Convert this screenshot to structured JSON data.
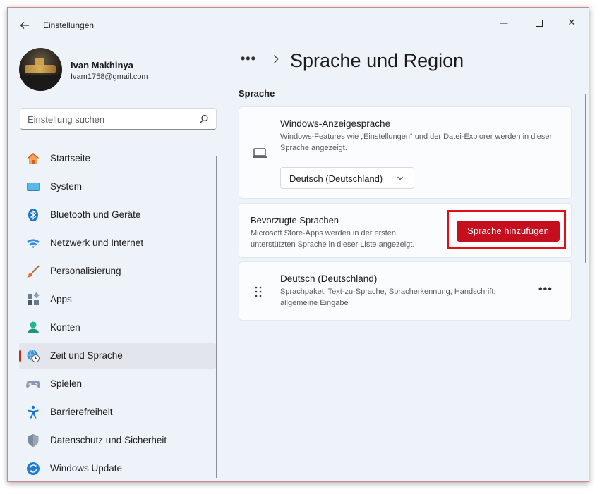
{
  "window": {
    "title": "Einstellungen",
    "back_icon": "arrow-left",
    "minimize": "—",
    "close": "✕"
  },
  "profile": {
    "name": "Ivan Makhinya",
    "email": "Ivam1758@gmail.com"
  },
  "search": {
    "placeholder": "Einstellung suchen"
  },
  "sidebar": {
    "items": [
      {
        "label": "Startseite",
        "icon": "home-icon"
      },
      {
        "label": "System",
        "icon": "system-display-icon"
      },
      {
        "label": "Bluetooth und Geräte",
        "icon": "bluetooth-icon"
      },
      {
        "label": "Netzwerk und Internet",
        "icon": "wifi-icon"
      },
      {
        "label": "Personalisierung",
        "icon": "paintbrush-icon"
      },
      {
        "label": "Apps",
        "icon": "apps-icon"
      },
      {
        "label": "Konten",
        "icon": "account-icon"
      },
      {
        "label": "Zeit und Sprache",
        "icon": "time-language-icon",
        "active": true
      },
      {
        "label": "Spielen",
        "icon": "gamepad-icon"
      },
      {
        "label": "Barrierefreiheit",
        "icon": "accessibility-icon"
      },
      {
        "label": "Datenschutz und Sicherheit",
        "icon": "shield-icon"
      },
      {
        "label": "Windows Update",
        "icon": "update-icon"
      }
    ]
  },
  "main": {
    "breadcrumb_more": "•••",
    "page_title": "Sprache und Region",
    "section_title": "Sprache",
    "display_language": {
      "title": "Windows-Anzeigesprache",
      "description": "Windows-Features wie „Einstellungen“ und der Datei-Explorer werden in dieser Sprache angezeigt.",
      "selected": "Deutsch (Deutschland)"
    },
    "preferred_languages": {
      "title": "Bevorzugte Sprachen",
      "description": "Microsoft Store-Apps werden in der ersten unterstützten Sprache in dieser Liste angezeigt.",
      "add_button": "Sprache hinzufügen"
    },
    "language_entry": {
      "title": "Deutsch (Deutschland)",
      "description": "Sprachpaket, Text-zu-Sprache, Spracherkennung, Handschrift, allgemeine Eingabe",
      "more": "•••"
    }
  },
  "colors": {
    "accent": "#c50f1f",
    "highlight": "#e10e12",
    "background": "#eef3f9",
    "card": "#fbfcfd"
  }
}
